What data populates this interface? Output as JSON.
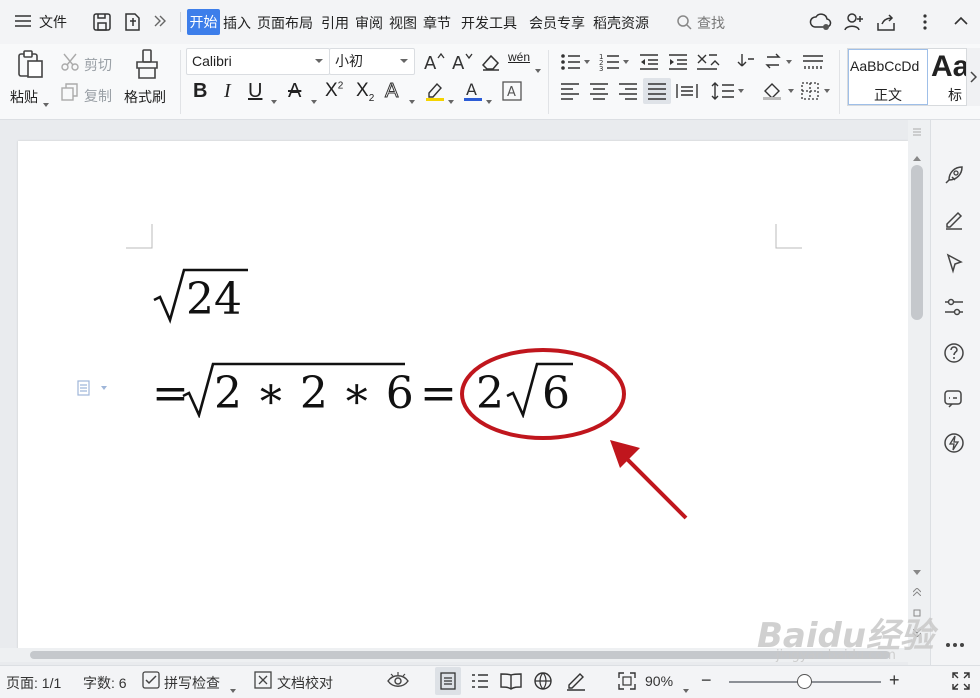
{
  "titlebar": {
    "file_menu": "文件",
    "tabs": [
      "开始",
      "插入",
      "页面布局",
      "引用",
      "审阅",
      "视图",
      "章节",
      "开发工具",
      "会员专享",
      "稻壳资源"
    ],
    "search_placeholder": "查找"
  },
  "ribbon": {
    "paste": "粘贴",
    "cut": "剪切",
    "copy": "复制",
    "format_painter": "格式刷",
    "font_name": "Calibri",
    "font_size": "小初",
    "phonetic": "wén",
    "style_normal_preview": "AaBbCcDd",
    "style_normal_label": "正文",
    "style_heading_preview": "Aa",
    "style_heading_label": "标"
  },
  "document": {
    "line1": {
      "radicand": "24"
    },
    "line2": {
      "prefix": "=",
      "radicand": "2 ∗ 2 ∗ 6",
      "equals": "=",
      "coefficient": "2",
      "result_radicand": "6"
    },
    "highlight_color": "#c0161d"
  },
  "statusbar": {
    "page": "页面: 1/1",
    "word_count": "字数: 6",
    "spell_check": "拼写检查",
    "doc_proof": "文档校对",
    "zoom": "90%"
  },
  "watermark": {
    "brand": "Baidu经验",
    "url": "jingyan.baidu.com"
  }
}
